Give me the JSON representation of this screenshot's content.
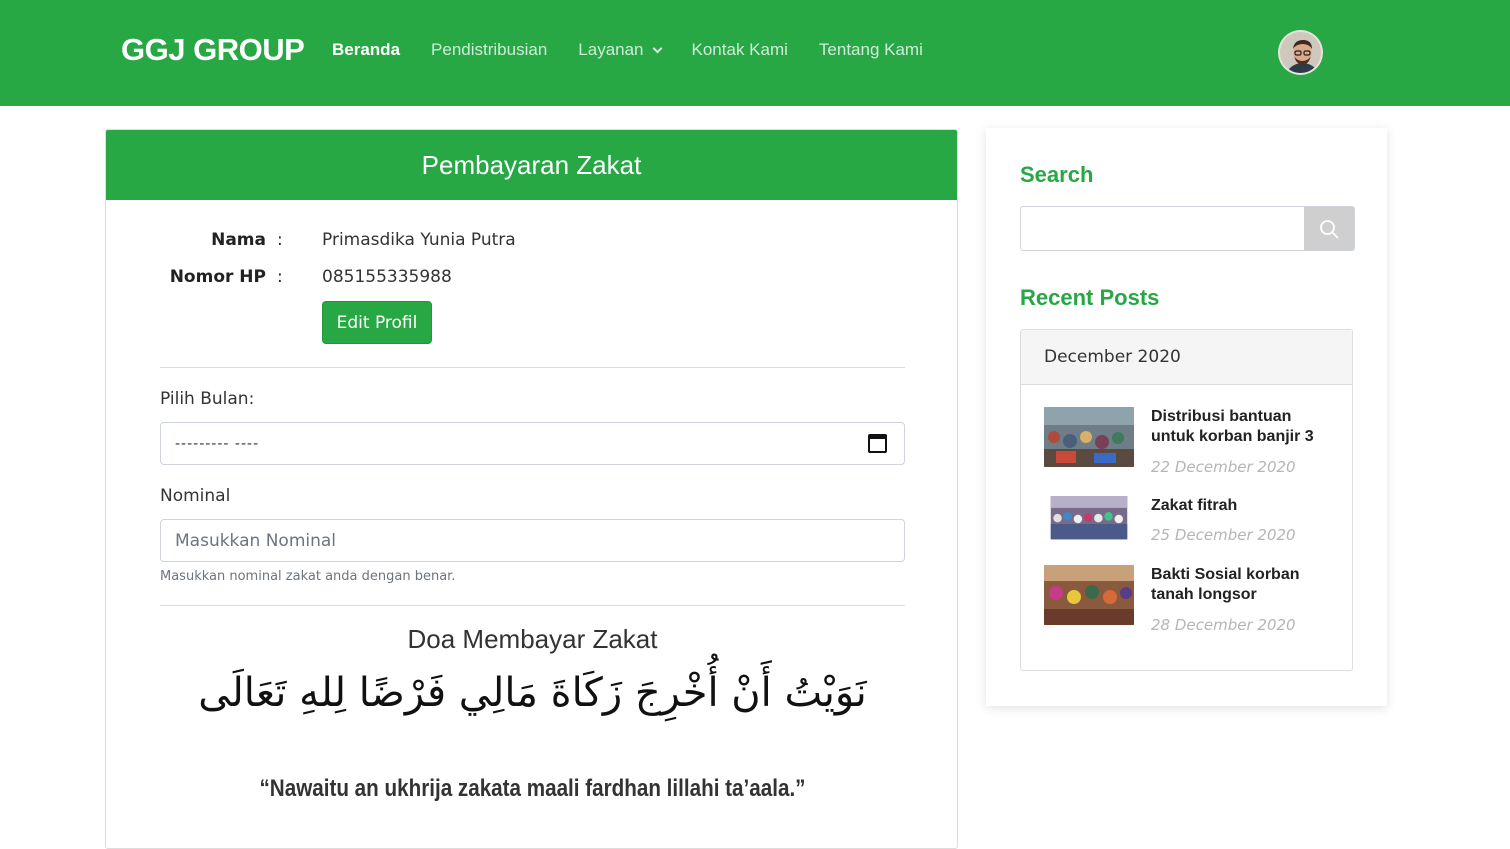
{
  "header": {
    "brand": "GGJ GROUP",
    "nav": [
      {
        "label": "Beranda",
        "active": true
      },
      {
        "label": "Pendistribusian",
        "active": false
      },
      {
        "label": "Layanan",
        "active": false,
        "dropdown": true
      },
      {
        "label": "Kontak Kami",
        "active": false
      },
      {
        "label": "Tentang Kami",
        "active": false
      }
    ],
    "avatar_icon": "user-avatar",
    "bg_color": "#28a745"
  },
  "form": {
    "title": "Pembayaran Zakat",
    "profile": {
      "name_label": "Nama",
      "name_value": "Primasdika Yunia Putra",
      "phone_label": "Nomor HP",
      "phone_value": "085155335988",
      "separator": ":",
      "edit_button": "Edit Profil"
    },
    "month_label": "Pilih Bulan:",
    "month_value": "--------- ----",
    "nominal_label": "Nominal",
    "nominal_placeholder": "Masukkan Nominal",
    "nominal_help": "Masukkan nominal zakat anda dengan benar.",
    "doa_title": "Doa Membayar Zakat",
    "doa_arabic": "نَوَيْتُ أَنْ أُخْرِجَ زَكَاةَ مَالِي فَرْضًا لِلهِ تَعَالَى",
    "doa_latin": "“Nawaitu an ukhrija zakata maali fardhan lillahi ta’aala.”"
  },
  "sidebar": {
    "search_title": "Search",
    "search_placeholder": "",
    "recent_title": "Recent Posts",
    "month_header": "December 2020",
    "posts": [
      {
        "title": "Distribusi bantuan untuk korban banjir 3",
        "date": "22 December 2020"
      },
      {
        "title": "Zakat fitrah",
        "date": "25 December 2020"
      },
      {
        "title": "Bakti Sosial korban tanah longsor",
        "date": "28 December 2020"
      }
    ]
  }
}
